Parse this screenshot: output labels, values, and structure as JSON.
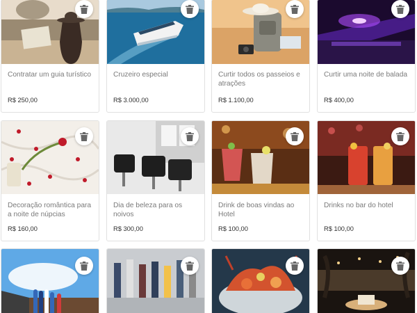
{
  "colors": {
    "card_border": "#e0e0e0",
    "title_text": "#7a7a7a",
    "price_text": "#2f2f2f",
    "delete_icon": "#666666"
  },
  "products": [
    {
      "title": "Contratar um guia turístico",
      "price": "R$ 250,00",
      "image": "woman-with-map-rome-photo"
    },
    {
      "title": "Cruzeiro especial",
      "price": "R$ 3.000,00",
      "image": "cruise-ship-photo"
    },
    {
      "title": "Curtir todos os passeios e atrações",
      "price": "R$ 1.100,00",
      "image": "travel-backpack-hat-camera-photo"
    },
    {
      "title": "Curtir uma noite de balada",
      "price": "R$ 400,00",
      "image": "nightclub-lights-photo"
    },
    {
      "title": "Decoração romântica para a noite de núpcias",
      "price": "R$ 160,00",
      "image": "rose-petals-bed-photo"
    },
    {
      "title": "Dia de beleza para os noivos",
      "price": "R$ 300,00",
      "image": "salon-chairs-photo"
    },
    {
      "title": "Drink de boas vindas ao Hotel",
      "price": "R$ 100,00",
      "image": "cocktails-bar-photo"
    },
    {
      "title": "Drinks no bar do hotel",
      "price": "R$ 100,00",
      "image": "two-cocktails-photo"
    },
    {
      "title": "",
      "price": "",
      "image": "surfboards-beach-photo"
    },
    {
      "title": "",
      "price": "",
      "image": "crowd-walking-photo"
    },
    {
      "title": "",
      "price": "",
      "image": "seafood-platter-photo"
    },
    {
      "title": "",
      "price": "",
      "image": "beach-dinner-night-photo"
    }
  ]
}
